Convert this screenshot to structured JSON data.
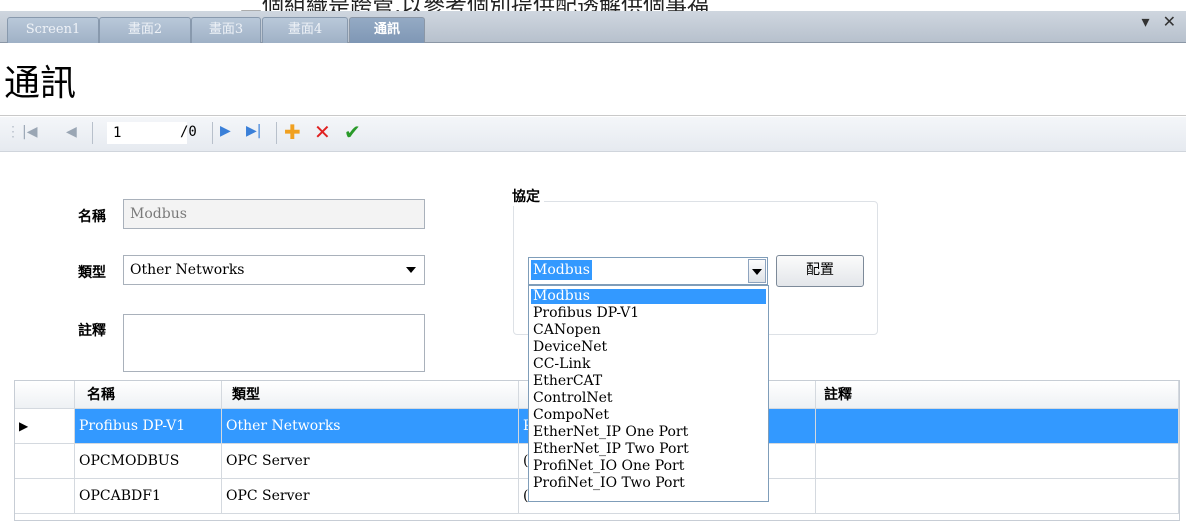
{
  "caption": "二個組織是跨管,以參考個別提供配透解供個事福",
  "tabs": [
    {
      "label": "Screen1"
    },
    {
      "label": "畫面2"
    },
    {
      "label": "畫面3"
    },
    {
      "label": "畫面4"
    },
    {
      "label": "通訊"
    }
  ],
  "window_controls": "▾ ✕",
  "title": "通訊",
  "navigator": {
    "position": "1",
    "total": "/0"
  },
  "form": {
    "name_label": "名稱",
    "name_value": "Modbus",
    "type_label": "類型",
    "type_value": "Other Networks",
    "comment_label": "註釋",
    "comment_value": "",
    "protocol_label": "協定",
    "protocol_value": "Modbus",
    "config_button": "配置"
  },
  "protocol_options": [
    "Modbus",
    "Profibus DP-V1",
    "CANopen",
    "DeviceNet",
    "CC-Link",
    "EtherCAT",
    "ControlNet",
    "CompoNet",
    "EtherNet_IP One Port",
    "EtherNet_IP Two Port",
    "ProfiNet_IO One Port",
    "ProfiNet_IO Two Port"
  ],
  "grid": {
    "headers": [
      "名稱",
      "類型",
      "",
      "註釋"
    ],
    "rows": [
      {
        "name": "Profibus DP-V1",
        "type": "Other Networks",
        "protocol": "P",
        "comment": ""
      },
      {
        "name": "OPCMODBUS",
        "type": "OPC Server",
        "protocol": "(",
        "comment": ""
      },
      {
        "name": "OPCABDF1",
        "type": "OPC Server",
        "protocol": "(",
        "comment": ""
      }
    ]
  },
  "colors": {
    "selection": "#3399ff",
    "add_icon": "#f0a020",
    "delete_icon": "#e02020",
    "save_icon": "#2a9a2a",
    "nav_icon": "#3a7fd8"
  }
}
